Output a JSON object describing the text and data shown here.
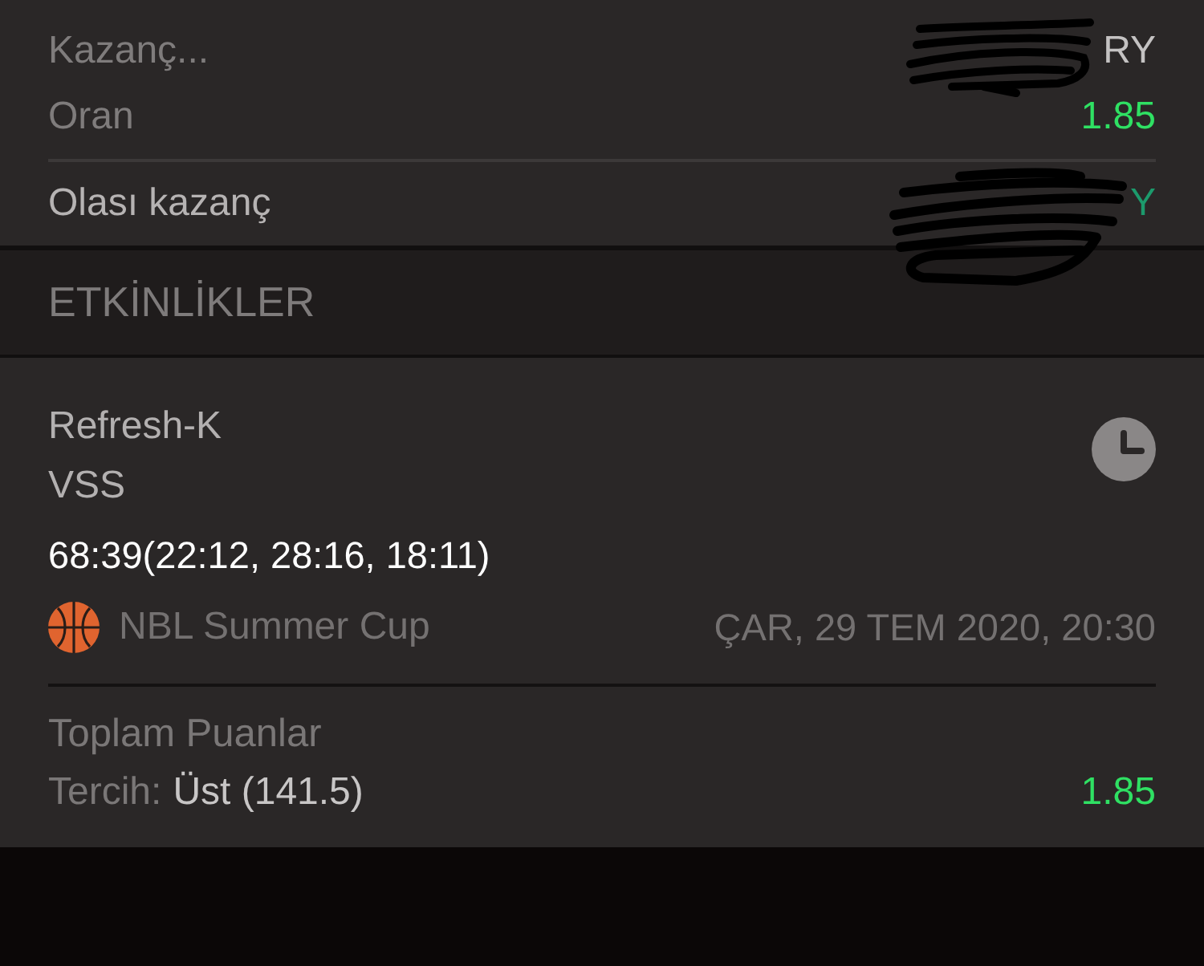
{
  "summary": {
    "rows": [
      {
        "label": "Kazanç...",
        "value": "RY",
        "kind": "stake"
      },
      {
        "label": "Oran",
        "value": "1.85",
        "kind": "odds"
      }
    ],
    "total": {
      "label": "Olası kazanç",
      "value": "Y"
    }
  },
  "section_header": {
    "title": "ETKİNLİKLER"
  },
  "events": [
    {
      "team_1": "Refresh-K",
      "team_2": "VSS",
      "score": "68:39(22:12, 28:16, 18:11)",
      "kind": "basketball",
      "league": "NBL Summer Cup",
      "date": "ÇAR, 29 TEM 2020, 20:30",
      "market": "Toplam Puanlar",
      "choice_label": "Tercih:",
      "choice": "Üst (141.5)",
      "odds": "1.85"
    }
  ]
}
